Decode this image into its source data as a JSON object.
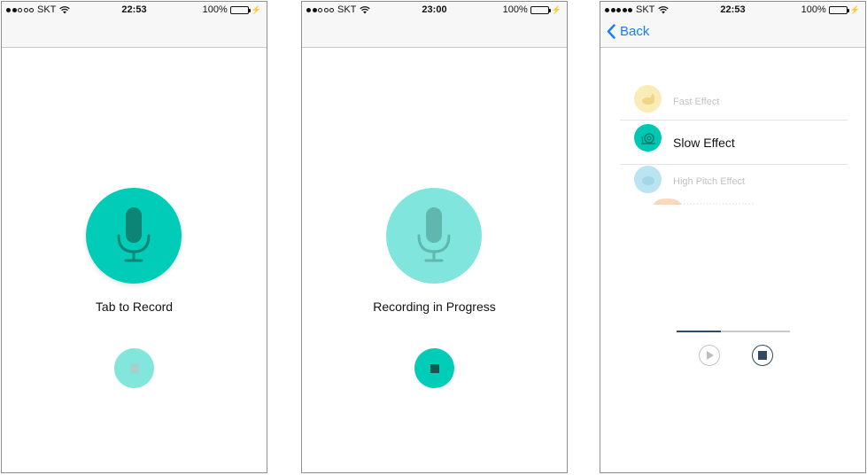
{
  "screens": [
    {
      "status": {
        "carrier": "SKT",
        "time": "22:53",
        "battery": "100%"
      },
      "caption": "Tab to Record"
    },
    {
      "status": {
        "carrier": "SKT",
        "time": "23:00",
        "battery": "100%"
      },
      "caption": "Recording in Progress"
    },
    {
      "status": {
        "carrier": "SKT",
        "time": "22:53",
        "battery": "100%"
      },
      "nav": {
        "back_label": "Back"
      },
      "effects": [
        {
          "label": "Fast Effect",
          "icon": "rabbit-icon",
          "color": "#f7e6a0",
          "selected": false
        },
        {
          "label": "Slow Effect",
          "icon": "snail-icon",
          "color": "#00c7b4",
          "selected": true
        },
        {
          "label": "High Pitch Effect",
          "icon": "chipmunk-icon",
          "color": "#a9def0",
          "selected": false
        }
      ],
      "playback": {
        "progress": 0.39
      }
    }
  ],
  "colors": {
    "accent": "#00ccb8",
    "accent_light": "#80e5dc",
    "ios_blue": "#157efb",
    "player_navy": "#2f4a63"
  }
}
